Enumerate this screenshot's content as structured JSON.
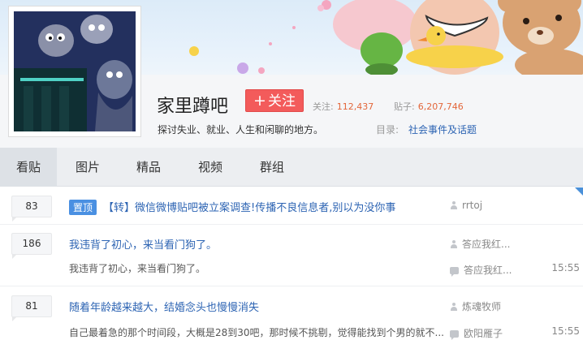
{
  "forum": {
    "name": "家里蹲吧",
    "follow_label": "关注",
    "follow_icon": "plus-icon",
    "followers_label": "关注:",
    "followers": "112,437",
    "posts_label": "贴子:",
    "posts": "6,207,746",
    "description": "探讨失业、就业、人生和闲聊的地方。",
    "catalog_label": "目录:",
    "catalog_value": "社会事件及话题"
  },
  "tabs": [
    {
      "label": "看贴"
    },
    {
      "label": "图片"
    },
    {
      "label": "精品"
    },
    {
      "label": "视频"
    },
    {
      "label": "群组"
    }
  ],
  "threads": [
    {
      "replies": "83",
      "badge": "置顶",
      "title": "【转】微信微博贴吧被立案调查!传播不良信息者,别以为没你事",
      "author": "rrtoj",
      "excerpt": "",
      "last_reply": "",
      "time": ""
    },
    {
      "replies": "186",
      "badge": "",
      "title": "我违背了初心，来当看门狗了。",
      "author": "答应我红...",
      "excerpt": "我违背了初心，来当看门狗了。",
      "last_reply": "答应我红...",
      "time": "15:55"
    },
    {
      "replies": "81",
      "badge": "",
      "title": "随着年龄越来越大，结婚念头也慢慢消失",
      "author": "炼魂牧师",
      "excerpt": "自己最着急的那个时间段，大概是28到30吧，那时候不挑剔，觉得能找到个男的就不...",
      "last_reply": "欧阳雁子",
      "time": "15:55"
    }
  ],
  "colors": {
    "accent": "#2d64b3",
    "follow": "#f35b5b",
    "stat_number": "#e3663a",
    "pin_badge": "#4a90e2"
  }
}
